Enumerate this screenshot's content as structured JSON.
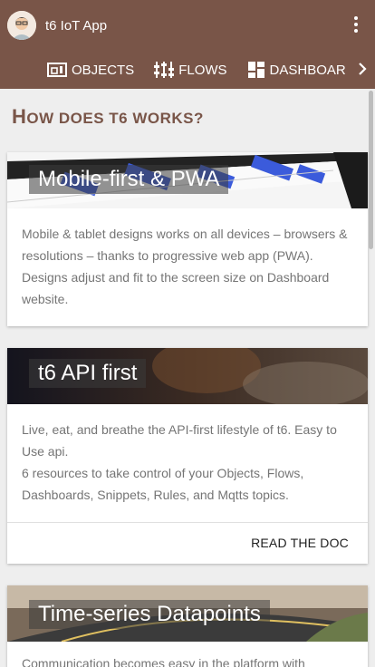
{
  "app": {
    "title": "t6 IoT App"
  },
  "tabs": [
    {
      "label": "OBJECTS",
      "icon": "objects-icon"
    },
    {
      "label": "FLOWS",
      "icon": "flows-icon"
    },
    {
      "label": "DASHBOAR",
      "icon": "dashboard-icon"
    }
  ],
  "section": {
    "title_first": "H",
    "title_rest": "OW DOES T6 WORKS?"
  },
  "cards": [
    {
      "title": "Mobile-first & PWA",
      "text": "Mobile & tablet designs works on all devices – browsers & resolutions – thanks to progressive web app (PWA). Designs adjust and fit to the screen size on Dashboard website."
    },
    {
      "title": "t6 API first",
      "text_line1": "Live, eat, and breathe the API-first lifestyle of t6. Easy to Use api.",
      "text_line2": "6 resources to take control of your Objects, Flows, Dashboards, Snippets, Rules, and Mqtts topics.",
      "action": "READ THE DOC"
    },
    {
      "title": "Time-series Datapoints",
      "text": "Communication becomes easy in the platform with"
    }
  ],
  "colors": {
    "primary": "#795548",
    "background": "#eeeeee"
  }
}
